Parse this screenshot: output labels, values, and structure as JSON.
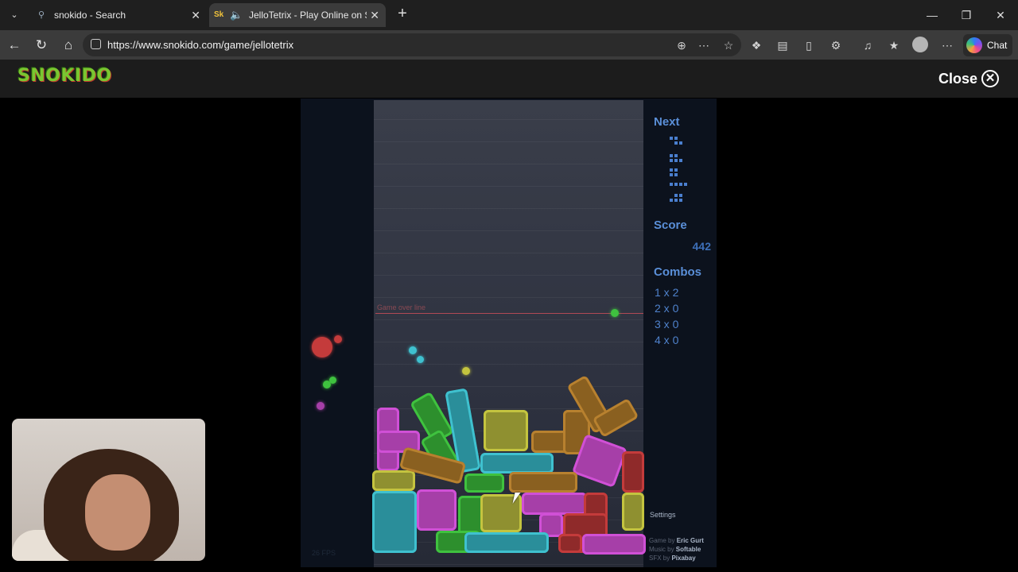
{
  "browser": {
    "tabs": [
      {
        "title": "snokido - Search"
      },
      {
        "title": "JelloTetrix - Play Online on Sn"
      }
    ],
    "url": "https://www.snokido.com/game/jellotetrix",
    "chat_label": "Chat"
  },
  "site": {
    "logo": "SNOKIDO",
    "close_label": "Close"
  },
  "game": {
    "game_over_label": "Game over line",
    "next_label": "Next",
    "score_label": "Score",
    "score_value": "442",
    "combos_label": "Combos",
    "combos": [
      "1 x 2",
      "2 x 0",
      "3 x 0",
      "4 x 0"
    ],
    "settings_label": "Settings",
    "credits": [
      {
        "prefix": "Game by ",
        "name": "Eric Gurt"
      },
      {
        "prefix": "Music by ",
        "name": "Softable"
      },
      {
        "prefix": "SFX by ",
        "name": "Pixabay"
      }
    ],
    "fps": "26 FPS",
    "colors": {
      "pink": "#d050d6",
      "green": "#3fc23f",
      "cyan": "#3fc1cf",
      "yellow": "#c4c43f",
      "orange": "#b8812f",
      "red": "#c43b3b",
      "ui_blue": "#5a8fd8"
    }
  }
}
